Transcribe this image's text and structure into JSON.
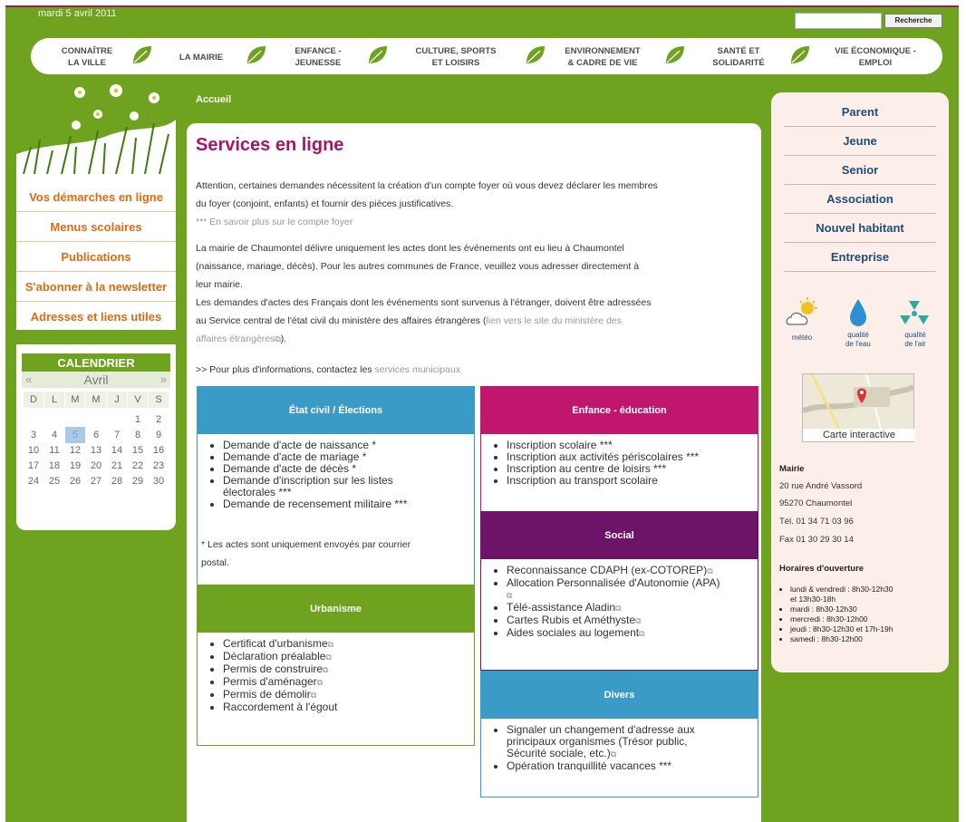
{
  "header": {
    "date": "mardi 5 avril 2011",
    "search": {
      "value": "",
      "button": "Recherche"
    }
  },
  "nav": [
    {
      "label_1": "CONNAÎTRE",
      "label_2": "LA VILLE"
    },
    {
      "label_1": "LA MAIRIE",
      "label_2": ""
    },
    {
      "label_1": "ENFANCE -",
      "label_2": "JEUNESSE"
    },
    {
      "label_1": "CULTURE, SPORTS",
      "label_2": "ET LOISIRS"
    },
    {
      "label_1": "ENVIRONNEMENT",
      "label_2": "& CADRE DE VIE"
    },
    {
      "label_1": "SANTÉ ET",
      "label_2": "SOLIDARITÉ"
    },
    {
      "label_1": "VIE ÉCONOMIQUE -",
      "label_2": "EMPLOI"
    }
  ],
  "left_menu": [
    "Vos démarches en ligne",
    "Menus scolaires",
    "Publications",
    "S'abonner à la newsletter",
    "Adresses et liens utiles"
  ],
  "calendar": {
    "title": "CALENDRIER",
    "month": "Avril",
    "prev": "«",
    "next": "»",
    "days": [
      "D",
      "L",
      "M",
      "M",
      "J",
      "V",
      "S"
    ],
    "weeks": [
      [
        "",
        "",
        "",
        "",
        "",
        "1",
        "2"
      ],
      [
        "3",
        "4",
        "5",
        "6",
        "7",
        "8",
        "9"
      ],
      [
        "10",
        "11",
        "12",
        "13",
        "14",
        "15",
        "16"
      ],
      [
        "17",
        "18",
        "19",
        "20",
        "21",
        "22",
        "23"
      ],
      [
        "24",
        "25",
        "26",
        "27",
        "28",
        "29",
        "30"
      ]
    ],
    "today": "5"
  },
  "main": {
    "breadcrumb": "Accueil",
    "title": "Services en ligne",
    "p1_l1": "Attention, certaines demandes nécessitent la création d'un compte foyer où vous devez déclarer les membres",
    "p1_l2": "du foyer (conjoint, enfants) et fournir des pièces justificatives.",
    "p1_link": "*** En savoir plus sur le compte foyer",
    "p2_l1": "La mairie de Chaumontel délivre uniquement les actes dont les événements ont eu lieu à Chaumontel",
    "p2_l2": "(naissance, mariage, décès). Pour les autres communes de France, veuillez vous adresser directement à",
    "p2_l3": "leur mairie.",
    "p3_l1": "Les demandes d'actes des Français dont les événements sont survenus à l'étranger, doivent être adressées",
    "p3_l2a": "au Service central de l'état civil du ministère des affaires étrangères (",
    "p3_l2b": "lien vers le site du ministère des",
    "p3_l3a": "affaires étrangères",
    "p3_l3b": ").",
    "p4a": ">> Pour plus d'informations, contactez les ",
    "p4b": "services municipaux"
  },
  "boxes": {
    "etat": {
      "title": "État civil / Élections",
      "items": [
        "Demande d'acte de naissance *",
        "Demande d'acte de mariage *",
        "Demande d'acte de décès *",
        "Demande d'inscription sur les listes",
        "électorales ***",
        "Demande de recensement militaire ***"
      ],
      "note_l1": "* Les actes sont uniquement envoyés par courrier",
      "note_l2": "postal."
    },
    "urbanisme": {
      "title": "Urbanisme",
      "items": [
        "Certificat d'urbanisme",
        "Déclaration préalable",
        "Permis de construire",
        "Permis d'aménager",
        "Permis de démolir",
        "Raccordement à l'égout"
      ]
    },
    "enfance": {
      "title": "Enfance - éducation",
      "items": [
        "Inscription scolaire ***",
        "Inscription aux activités périscolaires ***",
        "Inscription au centre de loisirs ***",
        "Inscription au transport scolaire"
      ]
    },
    "social": {
      "title": "Social",
      "items": [
        "Reconnaissance CDAPH (ex-COTOREP)",
        "Allocation Personnalisée d'Autonomie (APA)",
        "Télé-assistance Aladin",
        "Cartes Rubis et Améthyste",
        "Aides sociales au logement"
      ]
    },
    "divers": {
      "title": "Divers",
      "items": [
        "Signaler un changement d'adresse aux",
        "principaux organismes (Trésor public,",
        "Sécurité sociale, etc.)",
        "Opération tranquillité vacances ***"
      ]
    }
  },
  "right_menu": [
    "Parent",
    "Jeune",
    "Senior",
    "Association",
    "Nouvel habitant",
    "Entreprise"
  ],
  "widgets": {
    "meteo": "météo",
    "eau_1": "qualité",
    "eau_2": "de l'eau",
    "air_1": "qualité",
    "air_2": "de l'air"
  },
  "map": {
    "label": "Carte interactive"
  },
  "mairie": {
    "title": "Mairie",
    "address_1": "20 rue André Vassord",
    "address_2": "95270 Chaumontel",
    "tel": "Tél. 01 34 71 03 96",
    "fax": "Fax 01 30 29 30 14",
    "hours_title": "Horaires d'ouverture",
    "hours": [
      "lundi & vendredi : 8h30-12h30",
      "et 13h30-18h",
      "mardi : 8h30-12h30",
      "mercredi : 8h30-12h00",
      "jeudi : 8h30-12h30 et 17h-19h",
      "samedi : 8h30-12h00"
    ]
  },
  "colors": {
    "green": "#6fa21f",
    "blue_head": "#3b9bc7",
    "pink_head": "#c0166e",
    "purple_head": "#6e1468",
    "orange_menu": "#e06a10",
    "title": "#a2166e"
  }
}
